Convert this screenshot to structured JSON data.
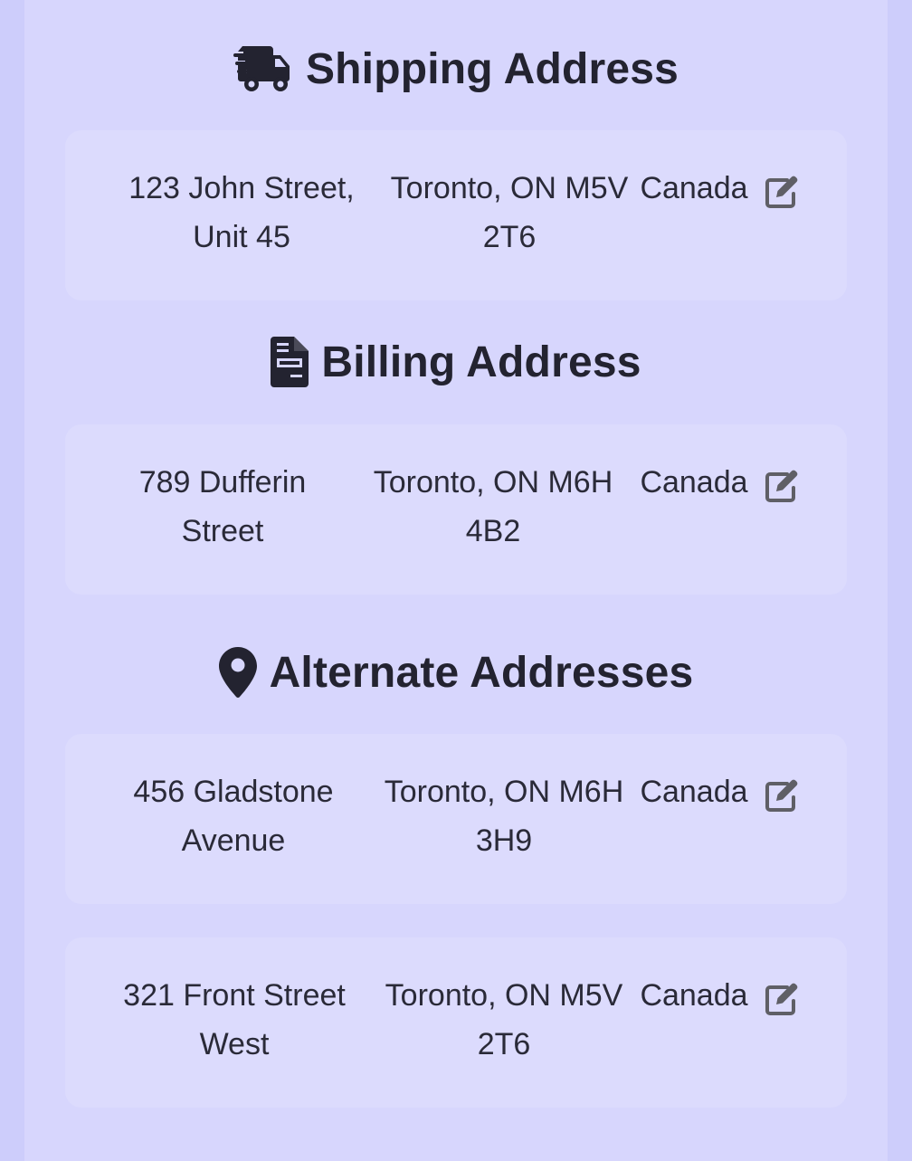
{
  "shipping": {
    "title": "Shipping Address",
    "icon": "truck-fast-icon",
    "address": {
      "street": "123 John Street, Unit 45",
      "city": "Toronto, ON M5V 2T6",
      "country": "Canada"
    }
  },
  "billing": {
    "title": "Billing Address",
    "icon": "file-invoice-icon",
    "address": {
      "street": "789 Dufferin Street",
      "city": "Toronto, ON M6H 4B2",
      "country": "Canada"
    }
  },
  "alternate": {
    "title": "Alternate Addresses",
    "icon": "location-pin-icon",
    "addresses": [
      {
        "street": "456 Gladstone Avenue",
        "city": "Toronto, ON M6H 3H9",
        "country": "Canada"
      },
      {
        "street": "321 Front Street West",
        "city": "Toronto, ON M5V 2T6",
        "country": "Canada"
      }
    ]
  },
  "colors": {
    "page_bg": "#cdcdfb",
    "panel_bg": "#d7d6fd",
    "card_bg": "#dcdbfd",
    "text": "#232330",
    "icon_gray": "#5f5f66"
  }
}
